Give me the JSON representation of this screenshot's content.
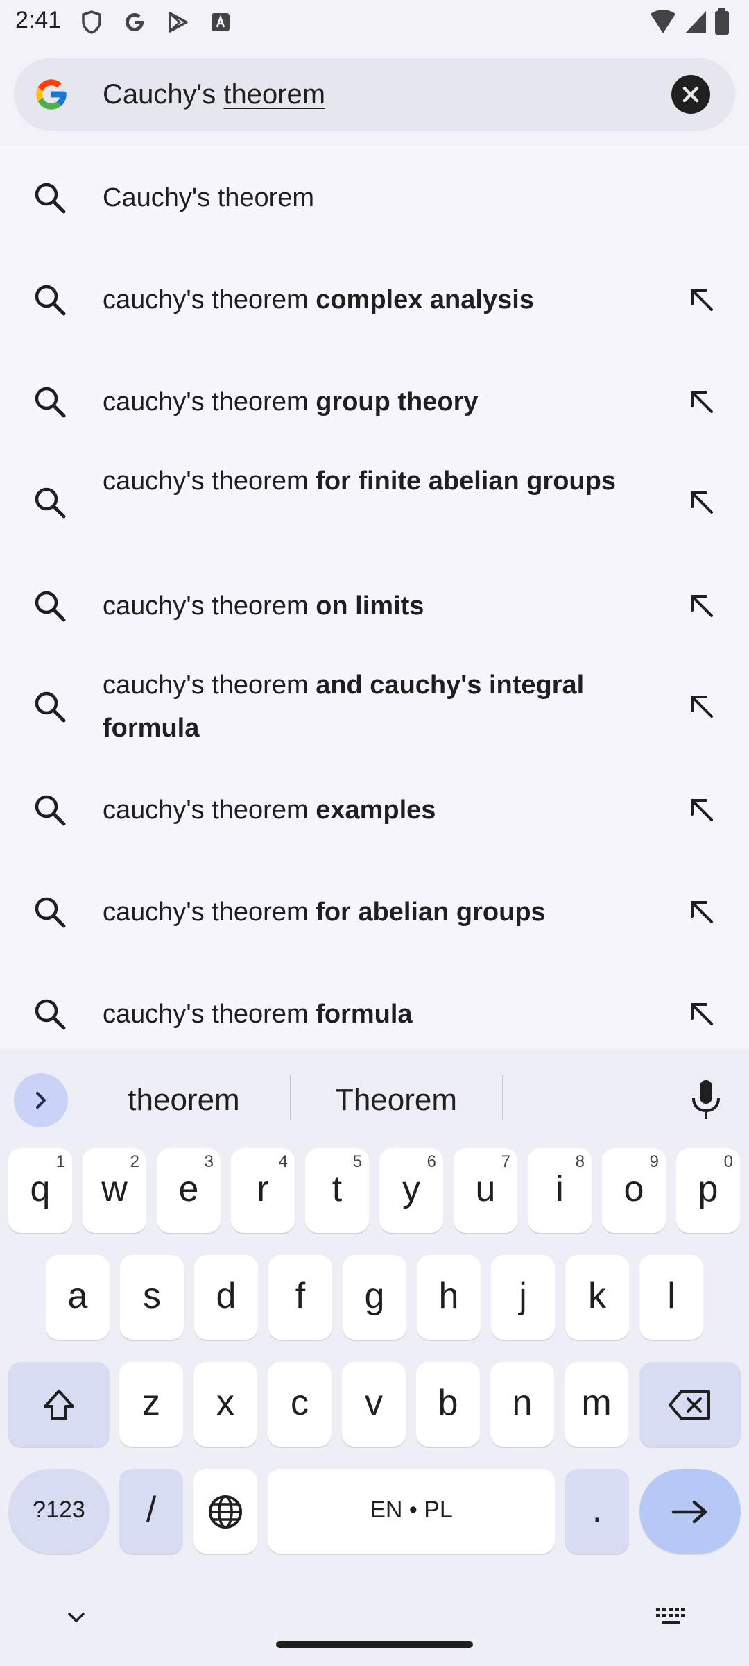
{
  "status_bar": {
    "time": "2:41"
  },
  "search": {
    "query_prefix": "Cauchy's ",
    "query_underlined": "theorem"
  },
  "suggestions": [
    {
      "normal": "Cauchy's theorem",
      "bold": ""
    },
    {
      "normal": "cauchy's theorem ",
      "bold": "complex analysis"
    },
    {
      "normal": "cauchy's theorem ",
      "bold": "group theory"
    },
    {
      "normal": "cauchy's theorem ",
      "bold": "for finite abelian groups"
    },
    {
      "normal": "cauchy's theorem ",
      "bold": "on limits"
    },
    {
      "normal": "cauchy's theorem ",
      "bold": "and cauchy's integral formula"
    },
    {
      "normal": "cauchy's theorem ",
      "bold": "examples"
    },
    {
      "normal": "cauchy's theorem ",
      "bold": "for abelian groups"
    },
    {
      "normal": "cauchy's theorem ",
      "bold": "formula"
    }
  ],
  "keyboard": {
    "suggestions": [
      "theorem",
      "Theorem"
    ],
    "row1": [
      {
        "k": "q",
        "n": "1"
      },
      {
        "k": "w",
        "n": "2"
      },
      {
        "k": "e",
        "n": "3"
      },
      {
        "k": "r",
        "n": "4"
      },
      {
        "k": "t",
        "n": "5"
      },
      {
        "k": "y",
        "n": "6"
      },
      {
        "k": "u",
        "n": "7"
      },
      {
        "k": "i",
        "n": "8"
      },
      {
        "k": "o",
        "n": "9"
      },
      {
        "k": "p",
        "n": "0"
      }
    ],
    "row2": [
      "a",
      "s",
      "d",
      "f",
      "g",
      "h",
      "j",
      "k",
      "l"
    ],
    "row3": [
      "z",
      "x",
      "c",
      "v",
      "b",
      "n",
      "m"
    ],
    "symbols_label": "?123",
    "slash_label": "/",
    "space_label": "EN • PL",
    "period_label": "."
  },
  "colors": {
    "accent": "#b8c8f6",
    "special_key": "#d7dcf2",
    "background": "#f3f2f9"
  }
}
